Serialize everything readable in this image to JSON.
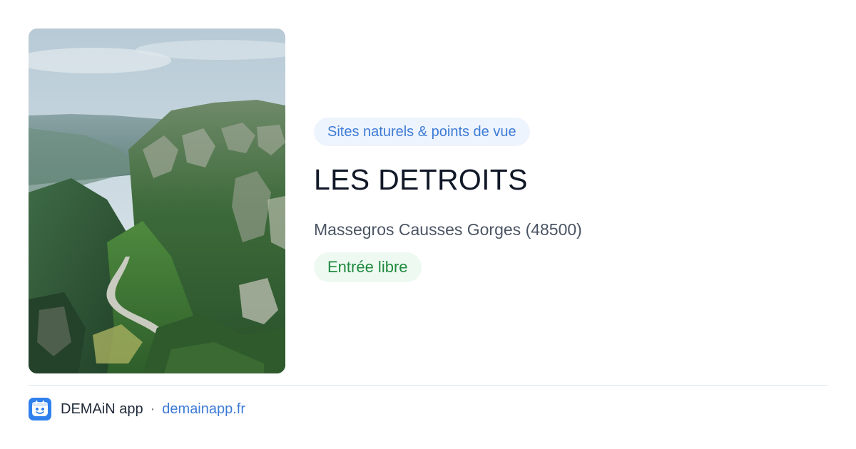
{
  "photo": {
    "icon": "gorge-landscape-photo"
  },
  "category": {
    "label": "Sites naturels & points de vue"
  },
  "place": {
    "title": "LES DETROITS",
    "location": "Massegros Causses Gorges (48500)",
    "access": "Entrée libre"
  },
  "footer": {
    "app_icon": "app-logo-icon",
    "app_name": "DEMAiN app",
    "separator": "·",
    "url": "demainapp.fr"
  },
  "colors": {
    "category_text": "#3d7bd6",
    "category_bg": "#eef4fd",
    "access_text": "#1f8a3f",
    "access_bg": "#eefaf1",
    "title": "#111827",
    "link": "#3d7bd6",
    "app_icon_bg": "#2f80ed"
  }
}
